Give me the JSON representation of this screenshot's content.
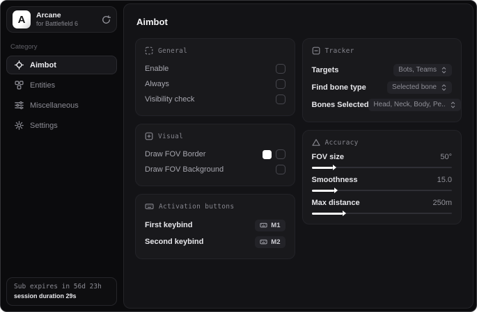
{
  "sidebar": {
    "app": {
      "logo_letter": "A",
      "name": "Arcane",
      "subtitle": "for Battlefield 6"
    },
    "category_label": "Category",
    "items": [
      {
        "label": "Aimbot",
        "icon": "crosshair-icon",
        "active": true
      },
      {
        "label": "Entities",
        "icon": "entities-icon",
        "active": false
      },
      {
        "label": "Miscellaneous",
        "icon": "sliders-icon",
        "active": false
      },
      {
        "label": "Settings",
        "icon": "gear-icon",
        "active": false
      }
    ],
    "footer": {
      "sub_expires": "Sub expires in 56d 23h",
      "session_duration": "session duration 29s"
    }
  },
  "main": {
    "title": "Aimbot",
    "general": {
      "title": "General",
      "rows": [
        {
          "label": "Enable",
          "checked": false
        },
        {
          "label": "Always",
          "checked": false
        },
        {
          "label": "Visibility check",
          "checked": false
        }
      ]
    },
    "visual": {
      "title": "Visual",
      "rows": [
        {
          "label": "Draw FOV Border",
          "swatch_color": "#ffffff",
          "checked": false
        },
        {
          "label": "Draw FOV Background",
          "checked": false
        }
      ]
    },
    "activation": {
      "title": "Activation buttons",
      "rows": [
        {
          "label": "First keybind",
          "key": "M1"
        },
        {
          "label": "Second keybind",
          "key": "M2"
        }
      ]
    },
    "tracker": {
      "title": "Tracker",
      "rows": [
        {
          "label": "Targets",
          "value": "Bots, Teams"
        },
        {
          "label": "Find bone type",
          "value": "Selected bone"
        },
        {
          "label": "Bones Selected",
          "value": "Head, Neck, Body, Pe.."
        }
      ]
    },
    "accuracy": {
      "title": "Accuracy",
      "sliders": [
        {
          "label": "FOV size",
          "value": "50°",
          "fill_percent": 15
        },
        {
          "label": "Smoothness",
          "value": "15.0",
          "fill_percent": 16
        },
        {
          "label": "Max distance",
          "value": "250m",
          "fill_percent": 22
        }
      ]
    }
  },
  "colors": {
    "window_background": "#0b0b0d",
    "panel_background": "#131316",
    "card_background": "#19191c",
    "accent": "#ffffff"
  }
}
